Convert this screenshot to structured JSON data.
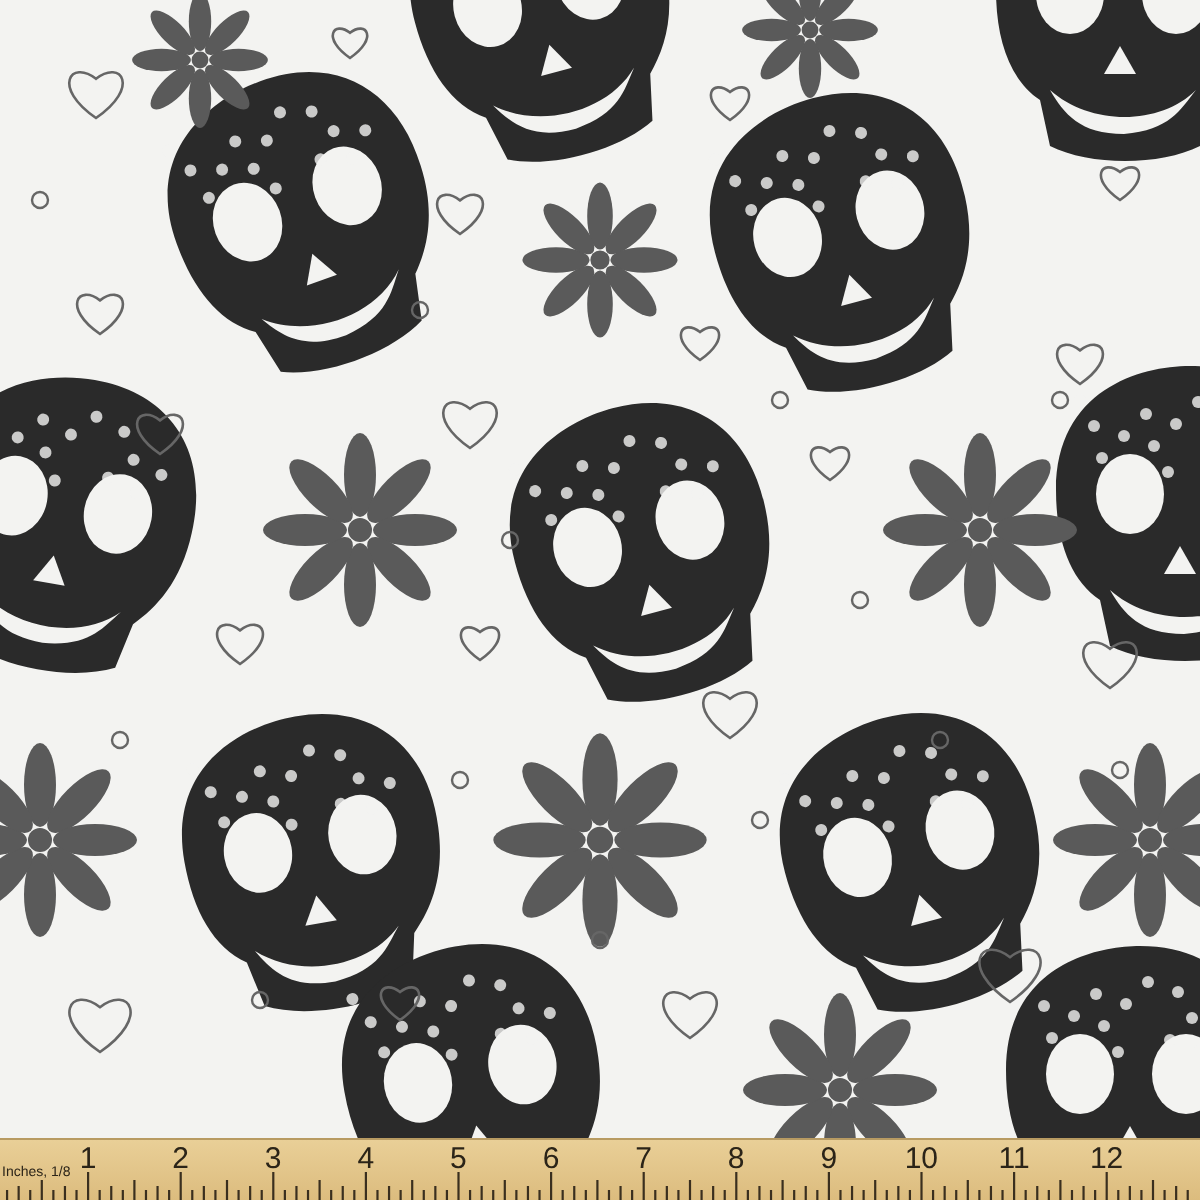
{
  "ruler": {
    "unit_label": "Inches, 1/8",
    "numbers": [
      "1",
      "2",
      "3",
      "4",
      "5",
      "6",
      "7",
      "8",
      "9",
      "10",
      "11",
      "12"
    ]
  }
}
